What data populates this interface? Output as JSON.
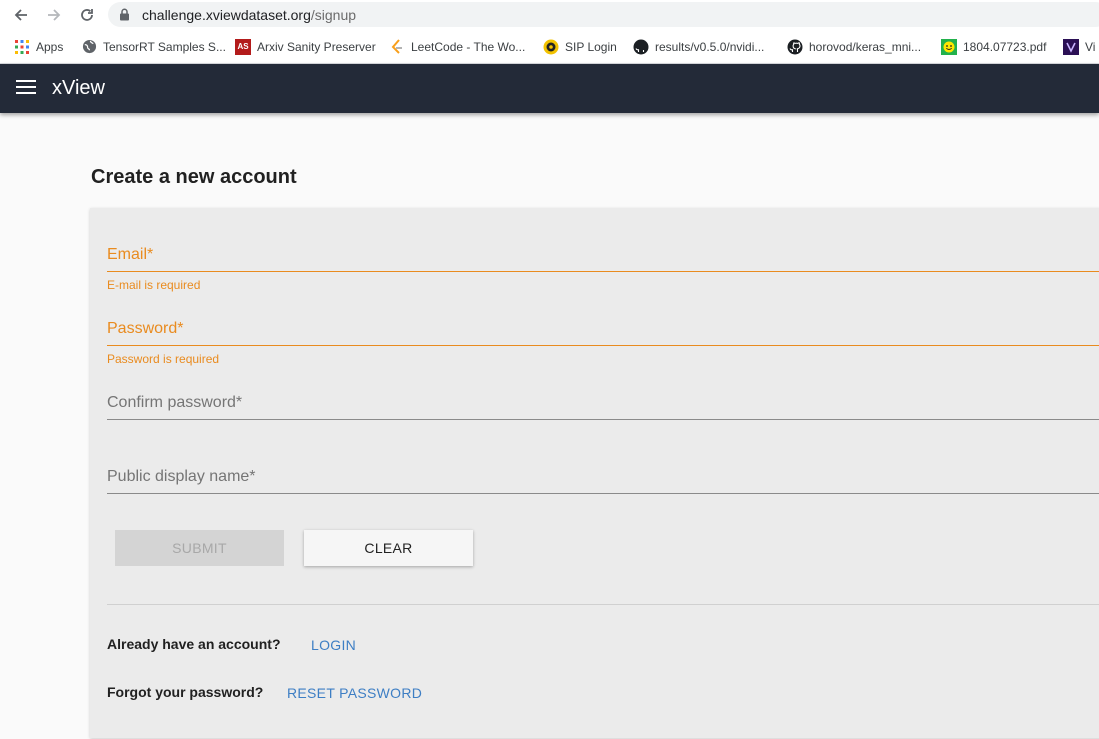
{
  "browser": {
    "url_host": "challenge.xviewdataset.org",
    "url_path": "/signup",
    "bookmarks": [
      {
        "label": "Apps",
        "icon": "apps-grid-icon"
      },
      {
        "label": "TensorRT Samples S...",
        "icon": "globe-icon"
      },
      {
        "label": "Arxiv Sanity Preserver",
        "icon": "arxiv-sanity-icon",
        "icon_text": "AS"
      },
      {
        "label": "LeetCode - The Wo...",
        "icon": "leetcode-icon"
      },
      {
        "label": "SIP Login",
        "icon": "sip-icon"
      },
      {
        "label": "results/v0.5.0/nvidi...",
        "icon": "github-icon"
      },
      {
        "label": "horovod/keras_mni...",
        "icon": "github-icon"
      },
      {
        "label": "1804.07723.pdf",
        "icon": "smiley-icon"
      },
      {
        "label": "Vi",
        "icon": "vi-icon"
      }
    ]
  },
  "appbar": {
    "title": "xView"
  },
  "page": {
    "heading": "Create a new account"
  },
  "form": {
    "email_label": "Email*",
    "email_error": "E-mail is required",
    "password_label": "Password*",
    "password_error": "Password is required",
    "confirm_label": "Confirm password*",
    "display_name_label": "Public display name*",
    "submit_label": "SUBMIT",
    "clear_label": "CLEAR"
  },
  "footer": {
    "have_account_text": "Already have an account?",
    "login_label": "LOGIN",
    "forgot_text": "Forgot your password?",
    "reset_label": "RESET PASSWORD"
  },
  "colors": {
    "appbar_bg": "#232a38",
    "error": "#e98b1f",
    "link": "#3d7ec4",
    "card_bg": "#ebebeb"
  }
}
